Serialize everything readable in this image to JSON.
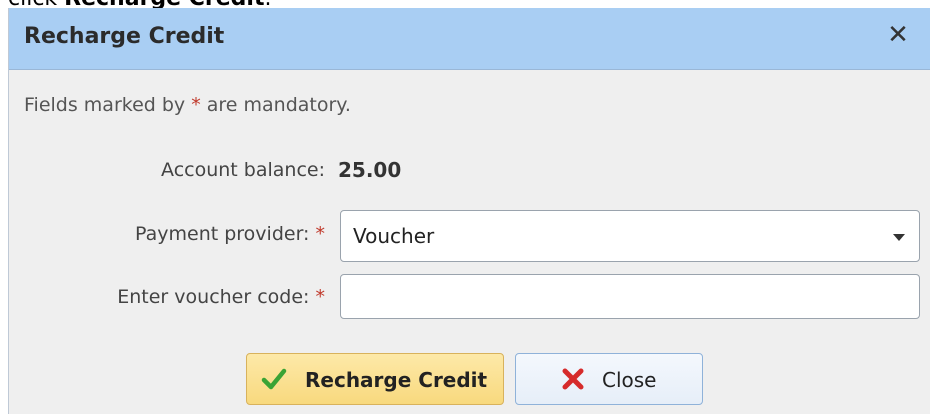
{
  "page_caption": {
    "prefix": "click ",
    "bold": "Recharge Credit",
    "suffix": "."
  },
  "dialog": {
    "title": "Recharge Credit",
    "close_glyph": "✕",
    "hint": {
      "before": "Fields marked by ",
      "star": "*",
      "after": " are mandatory."
    },
    "account_balance": {
      "label": "Account balance:",
      "value": "25.00"
    },
    "payment_provider": {
      "label": "Payment provider:",
      "required": "*",
      "selected": "Voucher"
    },
    "voucher_code": {
      "label": "Enter voucher code:",
      "required": "*",
      "value": "",
      "placeholder": ""
    },
    "buttons": {
      "recharge": "Recharge Credit",
      "close": "Close"
    }
  },
  "icons": {
    "close": "close-icon",
    "check": "checkmark-icon",
    "cross": "red-x-icon",
    "dropdown": "caret-down-icon"
  },
  "colors": {
    "titlebar": "#a9cef3",
    "body": "#efefef",
    "required": "#c0392b",
    "primary_button": "#f8d97e",
    "check_icon": "#3aa335",
    "cross_icon": "#d62b2b"
  }
}
